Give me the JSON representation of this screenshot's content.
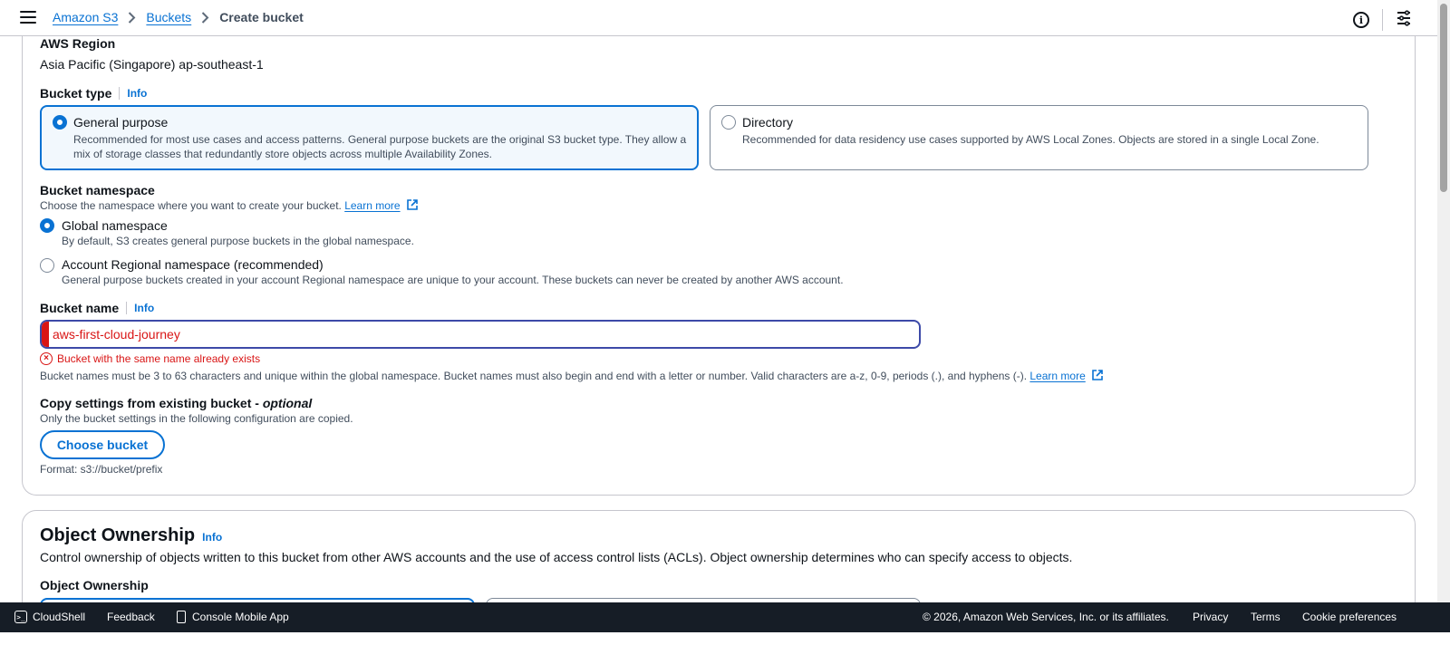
{
  "topbar": {
    "breadcrumbs": [
      "Amazon S3",
      "Buckets",
      "Create bucket"
    ]
  },
  "general": {
    "region_label": "AWS Region",
    "region_value": "Asia Pacific (Singapore) ap-southeast-1",
    "bucket_type_label": "Bucket type",
    "info": "Info",
    "bucket_types": [
      {
        "title": "General purpose",
        "desc": "Recommended for most use cases and access patterns. General purpose buckets are the original S3 bucket type. They allow a mix of storage classes that redundantly store objects across multiple Availability Zones.",
        "selected": true
      },
      {
        "title": "Directory",
        "desc": "Recommended for data residency use cases supported by AWS Local Zones. Objects are stored in a single Local Zone.",
        "selected": false
      }
    ],
    "namespace_label": "Bucket namespace",
    "namespace_desc": "Choose the namespace where you want to create your bucket.",
    "learn_more": "Learn more",
    "namespaces": [
      {
        "title": "Global namespace",
        "desc": "By default, S3 creates general purpose buckets in the global namespace.",
        "selected": true
      },
      {
        "title": "Account Regional namespace (recommended)",
        "desc": "General purpose buckets created in your account Regional namespace are unique to your account. These buckets can never be created by another AWS account.",
        "selected": false
      }
    ],
    "bucket_name_label": "Bucket name",
    "bucket_name_value": "aws-first-cloud-journey",
    "bucket_name_error": "Bucket with the same name already exists",
    "bucket_name_help": "Bucket names must be 3 to 63 characters and unique within the global namespace. Bucket names must also begin and end with a letter or number. Valid characters are a-z, 0-9, periods (.), and hyphens (-).",
    "copy_label": "Copy settings from existing bucket - ",
    "copy_optional": "optional",
    "copy_desc": "Only the bucket settings in the following configuration are copied.",
    "choose_bucket": "Choose bucket",
    "format": "Format: s3://bucket/prefix"
  },
  "ownership": {
    "title": "Object Ownership",
    "info": "Info",
    "desc": "Control ownership of objects written to this bucket from other AWS accounts and the use of access control lists (ACLs). Object ownership determines who can specify access to objects.",
    "sub_label": "Object Ownership"
  },
  "footer": {
    "cloudshell": "CloudShell",
    "feedback": "Feedback",
    "mobile_app": "Console Mobile App",
    "copyright": "© 2026, Amazon Web Services, Inc. or its affiliates.",
    "privacy": "Privacy",
    "terms": "Terms",
    "cookies": "Cookie preferences"
  },
  "colors": {
    "link": "#0972d3",
    "error": "#d91515",
    "footer_bg": "#161d26",
    "selected_tile_bg": "#f2f8fd"
  }
}
